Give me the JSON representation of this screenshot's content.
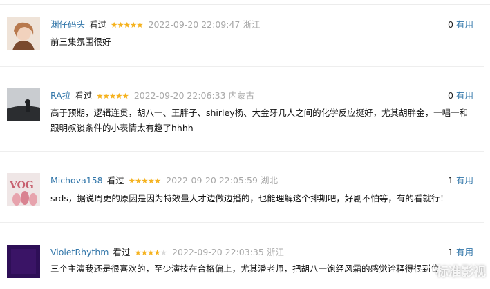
{
  "reviews": [
    {
      "user": "渊仔码头",
      "status": "看过",
      "rating": 5,
      "time": "2022-09-20 22:09:47",
      "location": "浙江",
      "useful_count": "0",
      "useful_label": "有用",
      "content": "前三集氛围很好",
      "avatar_colors": [
        "#e8d2c0",
        "#b8794d",
        "#5a3a2a"
      ]
    },
    {
      "user": "RA拉",
      "status": "看过",
      "rating": 5,
      "time": "2022-09-20 22:06:33",
      "location": "内蒙古",
      "useful_count": "0",
      "useful_label": "有用",
      "content": "高于预期，逻辑连贯，胡八一、王胖子、shirley杨、大金牙几人之间的化学反应挺好，尤其胡胖金，一唱一和跟明叔谈条件的小表情太有趣了hhhh",
      "avatar_colors": [
        "#b9bcc0",
        "#4b4e52",
        "#1e2023"
      ]
    },
    {
      "user": "Michova158",
      "status": "看过",
      "rating": 5,
      "time": "2022-09-20 22:05:59",
      "location": "湖北",
      "useful_count": "1",
      "useful_label": "有用",
      "content": "srds，据说周更的原因是因为特效量大才边做边播的，也能理解这个排期吧，好剧不怕等，有的看就行！",
      "avatar_text": "VOG",
      "avatar_colors": [
        "#efe6e6",
        "#e7a3ad",
        "#c7606f"
      ]
    },
    {
      "user": "VioletRhythm",
      "status": "看过",
      "rating": 4,
      "time": "2022-09-20 22:03:35",
      "location": "浙江",
      "useful_count": "1",
      "useful_label": "有用",
      "content": "三个主演我还是很喜欢的，至少演技在合格偏上，尤其潘老师，把胡八一饱经风霜的感觉诠释得很到位",
      "avatar_colors": [
        "#3a1466",
        "#2a0c52",
        "#1c0638"
      ]
    }
  ],
  "watermark": "标准影视",
  "accent": "#3377aa",
  "star_color": "#f5b21e"
}
